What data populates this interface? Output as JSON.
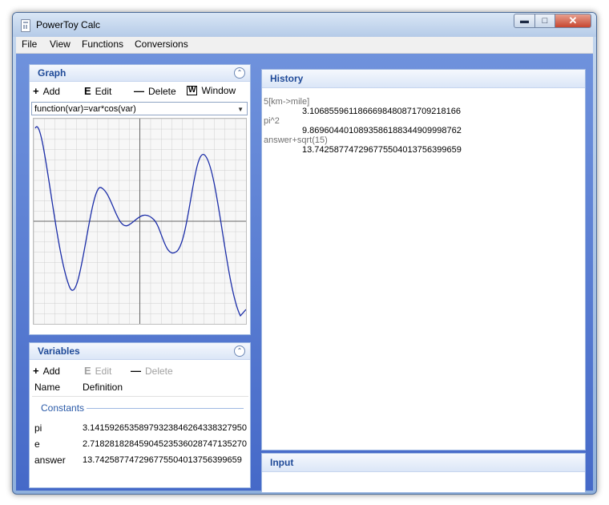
{
  "window": {
    "title": "PowerToy Calc"
  },
  "menu": [
    "File",
    "View",
    "Functions",
    "Conversions"
  ],
  "graph": {
    "title": "Graph",
    "toolbar": {
      "add": "Add",
      "edit": "Edit",
      "delete": "Delete",
      "window": "Window"
    },
    "function_selected": "function(var)=var*cos(var)"
  },
  "variables": {
    "title": "Variables",
    "toolbar": {
      "add": "Add",
      "edit": "Edit",
      "delete": "Delete"
    },
    "columns": [
      "Name",
      "Definition"
    ],
    "group": "Constants",
    "rows": [
      {
        "name": "pi",
        "definition": "3.14159265358979323846264338327950"
      },
      {
        "name": "e",
        "definition": "2.71828182845904523536028747135270"
      },
      {
        "name": "answer",
        "definition": "13.742587747296775504013756399659"
      }
    ]
  },
  "history": {
    "title": "History",
    "entries": [
      {
        "expr": "5[km->mile]",
        "result": "3.1068559611866698480871709218166"
      },
      {
        "expr": "pi^2",
        "result": "9.8696044010893586188344909998762"
      },
      {
        "expr": "answer+sqrt(15)",
        "result": "13.742587747296775504013756399659"
      }
    ]
  },
  "input": {
    "title": "Input"
  }
}
